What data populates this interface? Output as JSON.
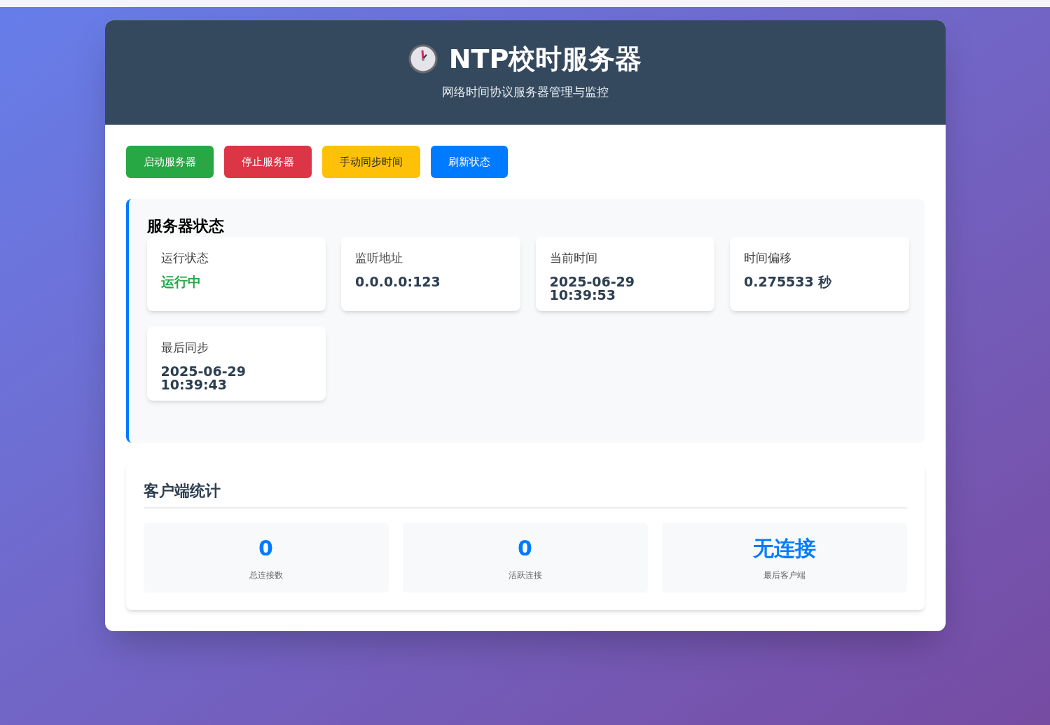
{
  "header": {
    "title": "NTP校时服务器",
    "subtitle": "网络时间协议服务器管理与监控"
  },
  "buttons": [
    {
      "label": "启动服务器",
      "kind": "success"
    },
    {
      "label": "停止服务器",
      "kind": "danger"
    },
    {
      "label": "手动同步时间",
      "kind": "warning"
    },
    {
      "label": "刷新状态",
      "kind": "primary"
    }
  ],
  "server_status": {
    "title": "服务器状态",
    "items": [
      {
        "label": "运行状态",
        "value": "运行中",
        "kind": "status"
      },
      {
        "label": "监听地址",
        "value": "0.0.0.0:123",
        "kind": "plain"
      },
      {
        "label": "当前时间",
        "value": "2025-06-29 10:39:53",
        "kind": "plain"
      },
      {
        "label": "时间偏移",
        "value": "0.275533 秒",
        "kind": "plain"
      },
      {
        "label": "最后同步",
        "value": "2025-06-29 10:39:43",
        "kind": "plain"
      }
    ]
  },
  "client_stats": {
    "title": "客户端统计",
    "items": [
      {
        "value": "0",
        "label": "总连接数"
      },
      {
        "value": "0",
        "label": "活跃连接"
      },
      {
        "value": "无连接",
        "label": "最后客户端"
      }
    ]
  }
}
